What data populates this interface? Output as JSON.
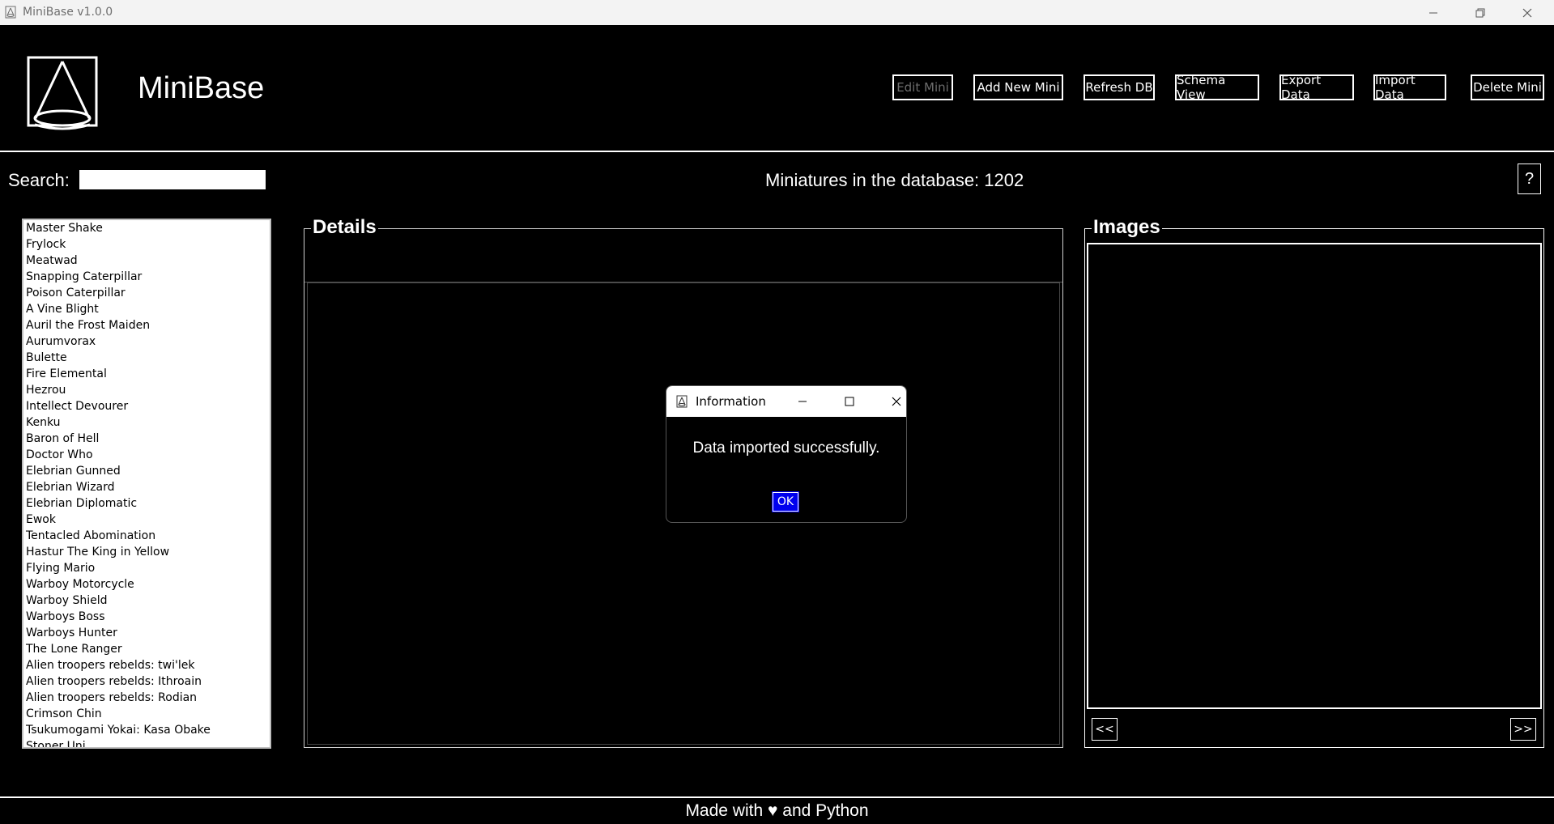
{
  "window": {
    "title": "MiniBase v1.0.0",
    "icon": "minibase-logo-icon"
  },
  "header": {
    "app_name": "MiniBase",
    "buttons": [
      {
        "label": "Edit Mini",
        "enabled": false
      },
      {
        "label": "Add New Mini",
        "enabled": true
      },
      {
        "label": "Refresh DB",
        "enabled": true
      },
      {
        "label": "Schema View",
        "enabled": true
      },
      {
        "label": "Export Data",
        "enabled": true
      },
      {
        "label": "Import Data",
        "enabled": true
      },
      {
        "label": "Delete Mini",
        "enabled": true
      }
    ]
  },
  "search": {
    "label": "Search:",
    "value": ""
  },
  "count_text": "Miniatures in the database: 1202",
  "help_label": "?",
  "minis": [
    "Master Shake",
    "Frylock",
    "Meatwad",
    "Snapping Caterpillar",
    "Poison Caterpillar",
    "A Vine Blight",
    "Auril the Frost Maiden",
    "Aurumvorax",
    "Bulette",
    "Fire Elemental",
    "Hezrou",
    "Intellect Devourer",
    "Kenku",
    "Baron of Hell",
    "Doctor Who",
    "Elebrian Gunned",
    "Elebrian Wizard",
    "Elebrian Diplomatic",
    "Ewok",
    "Tentacled Abomination",
    "Hastur The King in Yellow",
    "Flying Mario",
    "Warboy Motorcycle",
    "Warboy Shield",
    "Warboys Boss",
    "Warboys Hunter",
    "The Lone Ranger",
    "Alien troopers rebelds: twi'lek",
    "Alien troopers rebelds: Ithroain",
    "Alien troopers rebelds: Rodian",
    "Crimson Chin",
    "Tsukumogami Yokai: Kasa Obake",
    "Stoner Uni..."
  ],
  "details": {
    "title": "Details"
  },
  "images": {
    "title": "Images",
    "prev_label": "<<",
    "next_label": ">>"
  },
  "footer": "Made with ♥ and Python",
  "dialog": {
    "title": "Information",
    "message": "Data imported successfully.",
    "ok_label": "OK"
  }
}
